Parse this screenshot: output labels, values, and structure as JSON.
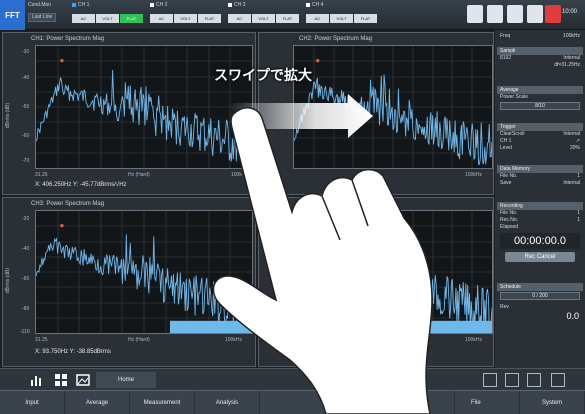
{
  "topbar": {
    "mode": "FFT",
    "cond_label": "Cond.Mon",
    "cond_sub": "Last Line",
    "channels": [
      {
        "name": "CH 1",
        "tags": [
          "AC",
          "VOLT",
          "FLAT"
        ],
        "active_tag": 2
      },
      {
        "name": "CH 2",
        "tags": [
          "AC",
          "VOLT",
          "FLAT"
        ],
        "active_tag": -1
      },
      {
        "name": "CH 3",
        "tags": [
          "AC",
          "VOLT",
          "FLAT"
        ],
        "active_tag": -1
      },
      {
        "name": "CH 4",
        "tags": [
          "AC",
          "VOLT",
          "FLAT"
        ],
        "active_tag": -1
      }
    ],
    "clock": "10:00"
  },
  "graphs": [
    {
      "title": "CH1: Power Spectrum Mag",
      "ylabel": "dBrms (dB)",
      "xstart": "31.25",
      "xend": "100k",
      "xaxis": "Hz (Hard)",
      "readout": "X: 406.250Hz Y: -45.77dBrms/√Hz",
      "yticks": [
        "-30",
        "-40",
        "-50",
        "-60",
        "-70"
      ]
    },
    {
      "title": "CH2: Power Spectrum Mag",
      "ylabel": "",
      "xstart": "",
      "xend": "100kHz",
      "xaxis": "",
      "readout": "",
      "yticks": []
    },
    {
      "title": "CH3: Power Spectrum Mag",
      "ylabel": "dBrms (dB)",
      "xstart": "31.25",
      "xend": "100kHz",
      "xaxis": "Hz (Hard)",
      "readout": "X: 93.750Hz Y: -38.85dBrms",
      "yticks": [
        "-20",
        "-40",
        "-60",
        "-80",
        "-110"
      ]
    },
    {
      "title": "",
      "ylabel": "dBrms",
      "xstart": "",
      "xend": "100kHz",
      "xaxis": "",
      "readout": "X: 400.0",
      "yticks": []
    }
  ],
  "sidebar": {
    "freq_label": "Freq",
    "freq_value": "100kHz",
    "sampling_header": "Sampli",
    "sampling_rows": [
      [
        "8192",
        "Internal"
      ],
      [
        "",
        "df=31.25Hz"
      ]
    ],
    "average_header": "Average",
    "average_rows": [
      [
        "Power Scale",
        ""
      ]
    ],
    "average_box": "8/10",
    "trigger_header": "Trigger",
    "trigger_rows": [
      [
        "ClearScroll",
        "Internal"
      ],
      [
        "CH 1",
        "↗"
      ],
      [
        "Level",
        "20%"
      ]
    ],
    "data_mem_header": "Data Memory",
    "data_mem_rows": [
      [
        "File No.",
        "1"
      ],
      [
        "Save",
        "Internal"
      ]
    ],
    "recording_header": "Recording",
    "recording_rows": [
      [
        "File No.",
        "1"
      ],
      [
        "Rec.No.",
        "1"
      ]
    ],
    "elapsed_label": "Elapsed",
    "elapsed_time": "00:00:00.0",
    "rec_cancel": "Rec Cancel",
    "schedule_header": "Schedule",
    "schedule_box": "0 / 200",
    "rev_label": "Rev",
    "rev_value": "0.0"
  },
  "toolbar": {
    "home_label": "Home"
  },
  "menubar": {
    "items": [
      "Input",
      "Average",
      "Measurement",
      "Analysis",
      "Display",
      "",
      "",
      "File",
      "System"
    ]
  },
  "gesture": {
    "label": "スワイプで拡大"
  },
  "colors": {
    "accent": "#2a6fcf",
    "active_tag": "#32c25a",
    "trace": "#6fb8ea",
    "peak": "#ff5a3c"
  }
}
